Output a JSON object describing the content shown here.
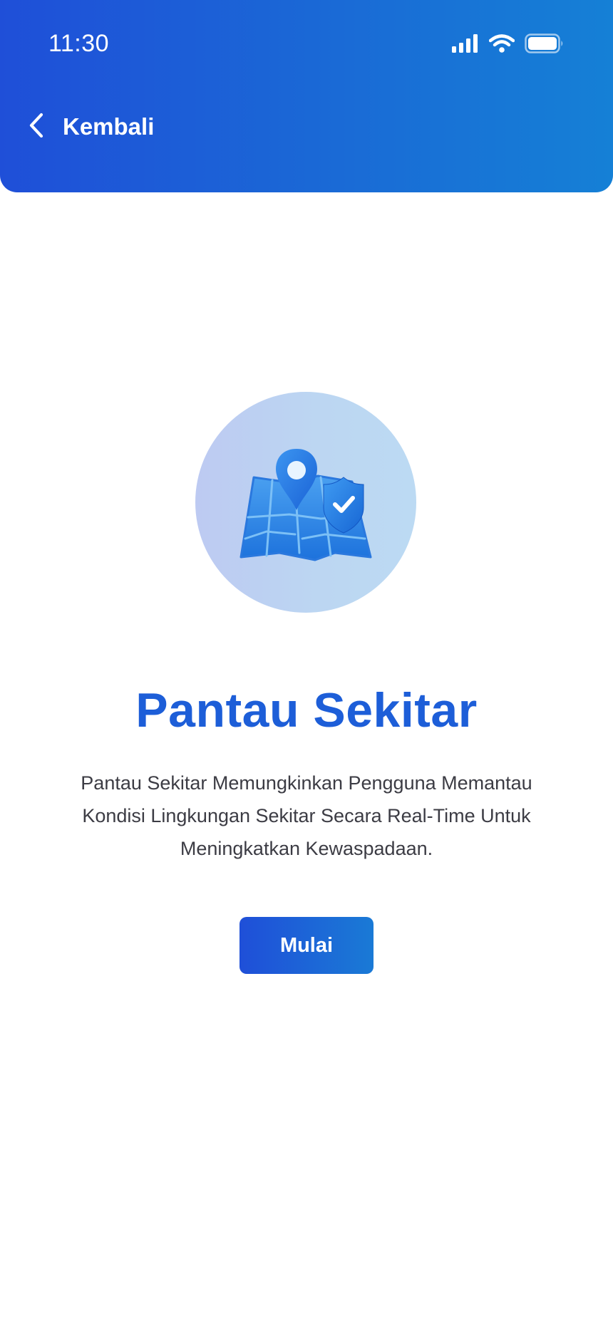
{
  "status_bar": {
    "time": "11:30",
    "icons": [
      "signal-icon",
      "wifi-icon",
      "battery-icon"
    ]
  },
  "header": {
    "back_label": "Kembali",
    "back_icon": "chevron-left-icon"
  },
  "illustration": {
    "icon": "map-pin-shield-icon"
  },
  "content": {
    "title": "Pantau Sekitar",
    "description": "Pantau Sekitar Memungkinkan Pengguna Memantau Kondisi Lingkungan Sekitar Secara Real-Time Untuk Meningkatkan Kewaspadaan.",
    "button_label": "Mulai"
  },
  "colors": {
    "primary": "#1f4fd8",
    "primary_light": "#1580d6",
    "title": "#1d5ed8",
    "body_text": "#3c3c44"
  }
}
